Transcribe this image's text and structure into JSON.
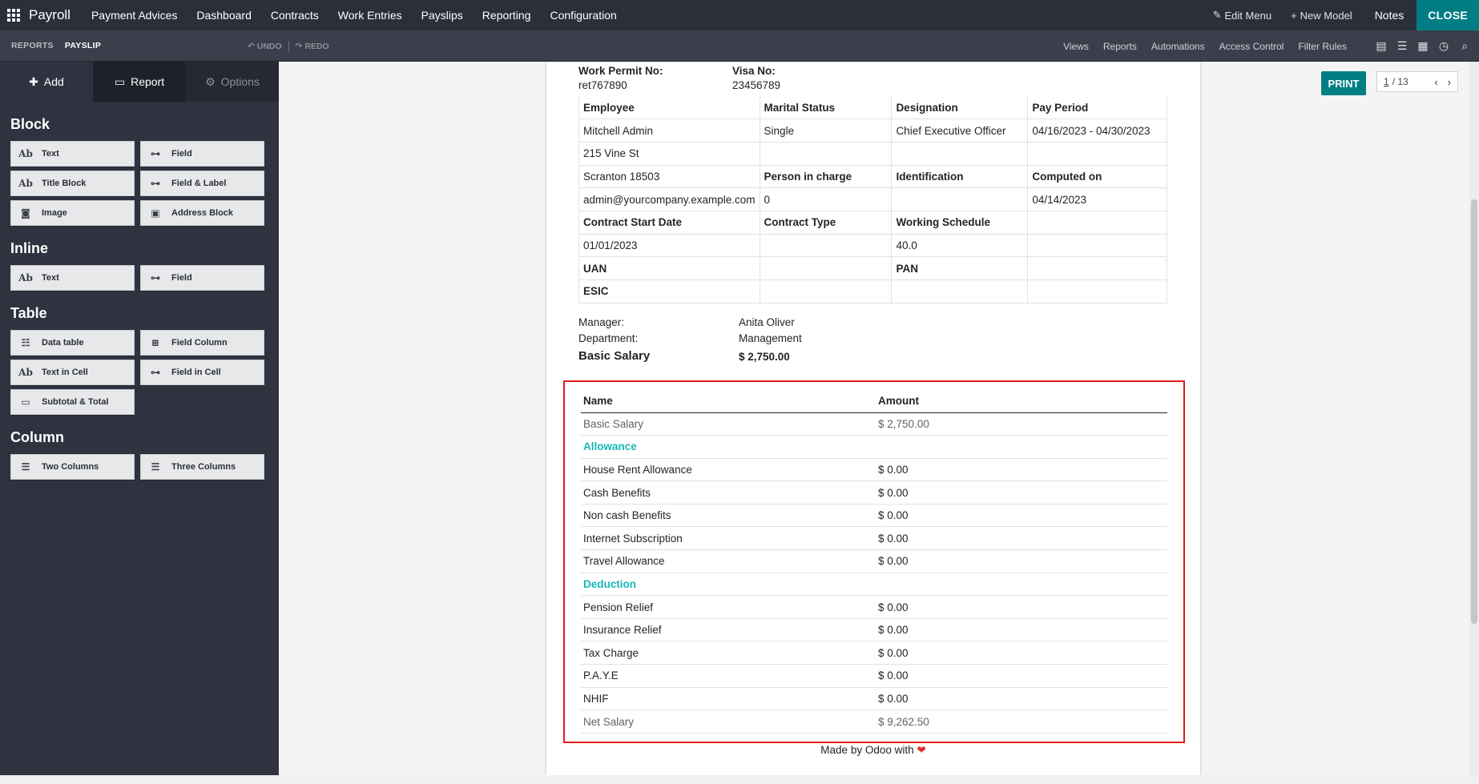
{
  "topbar": {
    "app_name": "Payroll",
    "menu": [
      "Payment Advices",
      "Dashboard",
      "Contracts",
      "Work Entries",
      "Payslips",
      "Reporting",
      "Configuration"
    ],
    "edit_menu": "Edit Menu",
    "new_model": "New Model",
    "notes": "Notes",
    "close": "CLOSE"
  },
  "subbar": {
    "breadcrumb": [
      "REPORTS",
      "PAYSLIP"
    ],
    "undo": "UNDO",
    "redo": "REDO",
    "links": [
      "Views",
      "Reports",
      "Automations",
      "Access Control",
      "Filter Rules"
    ]
  },
  "sidebar": {
    "tabs": [
      "Add",
      "Report",
      "Options"
    ],
    "sections": [
      {
        "title": "Block",
        "items": [
          {
            "icon": "Ab",
            "label": "Text"
          },
          {
            "icon": "field-icon",
            "label": "Field"
          },
          {
            "icon": "Ab",
            "label": "Title Block"
          },
          {
            "icon": "field-icon",
            "label": "Field & Label"
          },
          {
            "icon": "camera-icon",
            "label": "Image"
          },
          {
            "icon": "address-card-icon",
            "label": "Address Block"
          }
        ]
      },
      {
        "title": "Inline",
        "items": [
          {
            "icon": "Ab",
            "label": "Text"
          },
          {
            "icon": "field-icon",
            "label": "Field"
          }
        ]
      },
      {
        "title": "Table",
        "items": [
          {
            "icon": "list-icon",
            "label": "Data table"
          },
          {
            "icon": "plus-square-icon",
            "label": "Field Column"
          },
          {
            "icon": "Ab",
            "label": "Text in Cell"
          },
          {
            "icon": "field-icon",
            "label": "Field in Cell"
          },
          {
            "icon": "money-icon",
            "label": "Subtotal & Total"
          }
        ]
      },
      {
        "title": "Column",
        "items": [
          {
            "icon": "align-left-icon",
            "label": "Two Columns"
          },
          {
            "icon": "align-left-icon",
            "label": "Three Columns"
          }
        ]
      }
    ]
  },
  "toolbar": {
    "print": "PRINT",
    "pager_current": "1",
    "pager_total": "/ 13"
  },
  "document": {
    "work_permit_label": "Work Permit No:",
    "work_permit_value": "ret767890",
    "visa_label": "Visa No:",
    "visa_value": "23456789",
    "info_rows": [
      [
        {
          "t": "Employee",
          "b": true
        },
        {
          "t": "Marital Status",
          "b": true
        },
        {
          "t": "Designation",
          "b": true
        },
        {
          "t": "Pay Period",
          "b": true
        }
      ],
      [
        {
          "t": "Mitchell Admin"
        },
        {
          "t": "Single"
        },
        {
          "t": "Chief Executive Officer"
        },
        {
          "t": "04/16/2023 - 04/30/2023"
        }
      ],
      [
        {
          "t": "215 Vine St"
        },
        {
          "t": ""
        },
        {
          "t": ""
        },
        {
          "t": ""
        }
      ],
      [
        {
          "t": "Scranton 18503"
        },
        {
          "t": "Person in charge",
          "b": true
        },
        {
          "t": "Identification",
          "b": true
        },
        {
          "t": "Computed on",
          "b": true
        }
      ],
      [
        {
          "t": "admin@yourcompany.example.com"
        },
        {
          "t": "0"
        },
        {
          "t": ""
        },
        {
          "t": "04/14/2023"
        }
      ],
      [
        {
          "t": "Contract Start Date",
          "b": true
        },
        {
          "t": "Contract Type",
          "b": true
        },
        {
          "t": "Working Schedule",
          "b": true
        },
        {
          "t": ""
        }
      ],
      [
        {
          "t": "01/01/2023"
        },
        {
          "t": ""
        },
        {
          "t": "40.0"
        },
        {
          "t": ""
        }
      ],
      [
        {
          "t": "UAN",
          "b": true
        },
        {
          "t": ""
        },
        {
          "t": "PAN",
          "b": true
        },
        {
          "t": ""
        }
      ],
      [
        {
          "t": "ESIC",
          "b": true
        },
        {
          "t": ""
        },
        {
          "t": ""
        },
        {
          "t": ""
        }
      ]
    ],
    "manager_label": "Manager:",
    "manager_value": "Anita Oliver",
    "department_label": "Department:",
    "department_value": "Management",
    "basic_salary_label": "Basic Salary",
    "basic_salary_value": "$ 2,750.00",
    "salary_table": {
      "headers": [
        "Name",
        "Amount"
      ],
      "rows": [
        {
          "name": "Basic Salary",
          "amount": "$ 2,750.00",
          "kind": "total"
        },
        {
          "name": "Allowance",
          "amount": "",
          "kind": "category"
        },
        {
          "name": "House Rent Allowance",
          "amount": "$ 0.00",
          "kind": "line"
        },
        {
          "name": "Cash Benefits",
          "amount": "$ 0.00",
          "kind": "line"
        },
        {
          "name": "Non cash Benefits",
          "amount": "$ 0.00",
          "kind": "line"
        },
        {
          "name": "Internet Subscription",
          "amount": "$ 0.00",
          "kind": "line"
        },
        {
          "name": "Travel Allowance",
          "amount": "$ 0.00",
          "kind": "line"
        },
        {
          "name": "Deduction",
          "amount": "",
          "kind": "category"
        },
        {
          "name": "Pension Relief",
          "amount": "$ 0.00",
          "kind": "line"
        },
        {
          "name": "Insurance Relief",
          "amount": "$ 0.00",
          "kind": "line"
        },
        {
          "name": "Tax Charge",
          "amount": "$ 0.00",
          "kind": "line"
        },
        {
          "name": "P.A.Y.E",
          "amount": "$ 0.00",
          "kind": "line"
        },
        {
          "name": "NHIF",
          "amount": "$ 0.00",
          "kind": "line"
        },
        {
          "name": "Net Salary",
          "amount": "$ 9,262.50",
          "kind": "total"
        }
      ]
    },
    "footer": "Made by Odoo with"
  },
  "colors": {
    "topbar": "#2b2f3a",
    "accent": "#017e84",
    "highlight_border": "#e41b1b",
    "category": "#17b8b8",
    "total_amount": "#8b4a8f"
  }
}
